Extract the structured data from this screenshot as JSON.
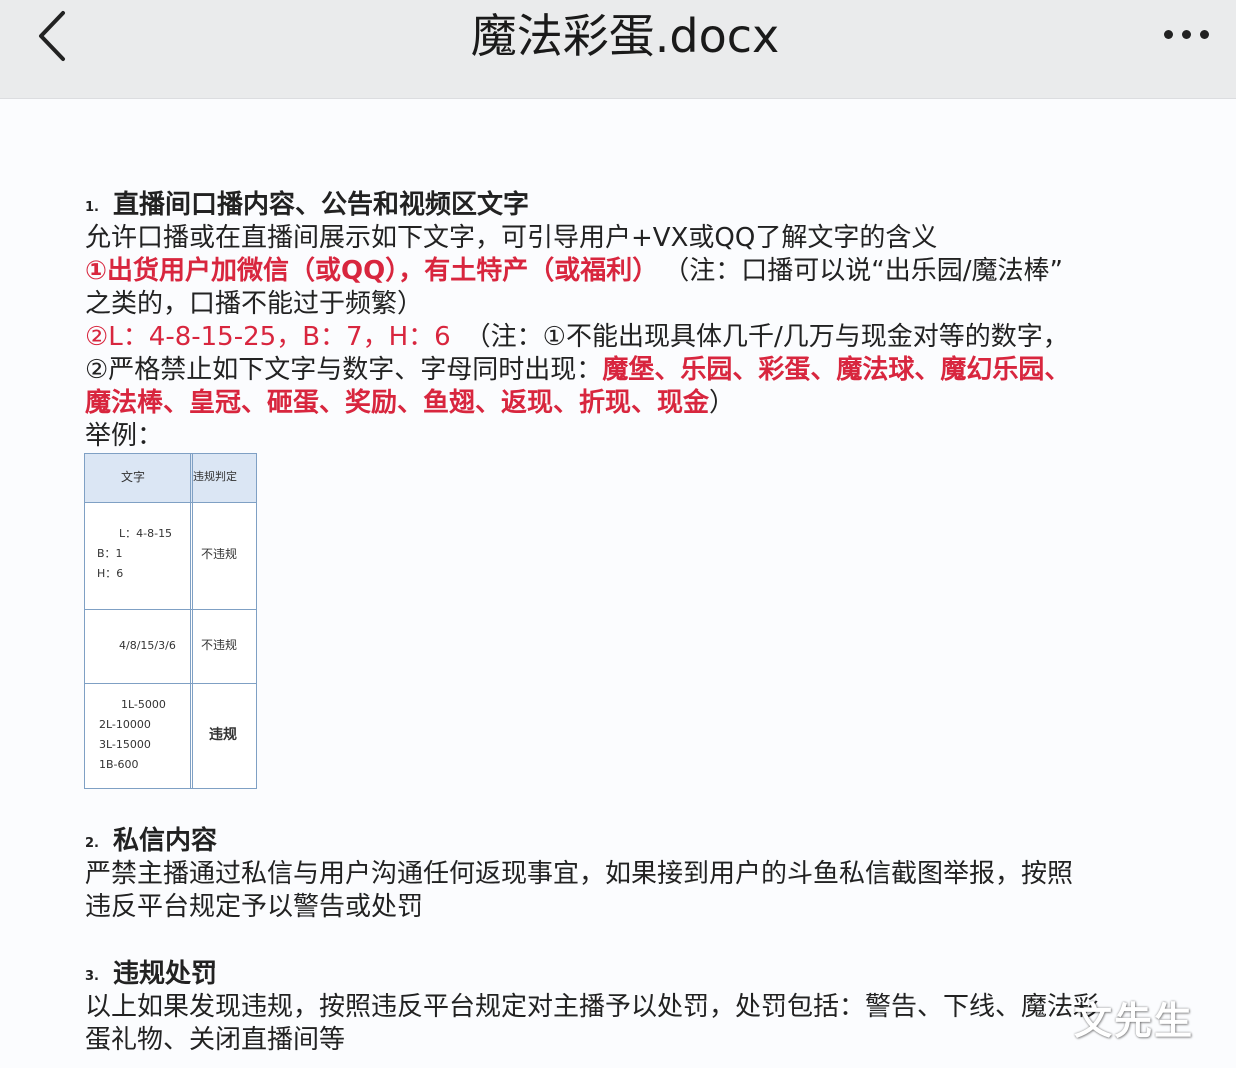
{
  "header": {
    "title": "魔法彩蛋.docx",
    "back_icon": "chevron-left-icon",
    "more_icon": "more-horizontal-icon"
  },
  "section1": {
    "number": "1.",
    "title": "直播间口播内容、公告和视频区文字",
    "intro": "允许口播或在直播间展示如下文字，可引导用户+VX或QQ了解文字的含义",
    "item1_red": "①出货用户加微信（或QQ），有土特产（或福利）",
    "item1_note": "（注：口播可以说“出乐园/魔法棒”",
    "item1_cont": "之类的，口播不能过于频繁）",
    "item2_red": "②L：4-8-15-25，B：7，H：6",
    "item2_note": "（注：①不能出现具体几千/几万与现金对等的数字，",
    "item3_lead": "②严格禁止如下文字与数字、字母同时出现：",
    "item3_words": "魔堡、乐园、彩蛋、魔法球、魔幻乐园、",
    "item4_words": "魔法棒、皇冠、砸蛋、奖励、鱼翅、返现、折现、现金",
    "item4_close": "）",
    "example_label": "举例："
  },
  "table": {
    "headers": [
      "文字",
      "违规判定"
    ],
    "rows": [
      {
        "text_lines": [
          "L：4-8-15",
          "B：1",
          "H：6"
        ],
        "result": "不违规"
      },
      {
        "text_lines": [
          "4/8/15/3/6"
        ],
        "result": "不违规"
      },
      {
        "text_lines": [
          "1L-5000",
          "2L-10000",
          "3L-15000",
          "1B-600"
        ],
        "result": "违规"
      }
    ]
  },
  "section2": {
    "number": "2.",
    "title": "私信内容",
    "line1": "严禁主播通过私信与用户沟通任何返现事宜，如果接到用户的斗鱼私信截图举报，按照",
    "line2": "违反平台规定予以警告或处罚"
  },
  "section3": {
    "number": "3.",
    "title": "违规处罚",
    "line1": "以上如果发现违规，按照违反平台规定对主播予以处罚，处罚包括：警告、下线、魔法彩",
    "line2": "蛋礼物、关闭直播间等"
  },
  "watermark": "文先生"
}
